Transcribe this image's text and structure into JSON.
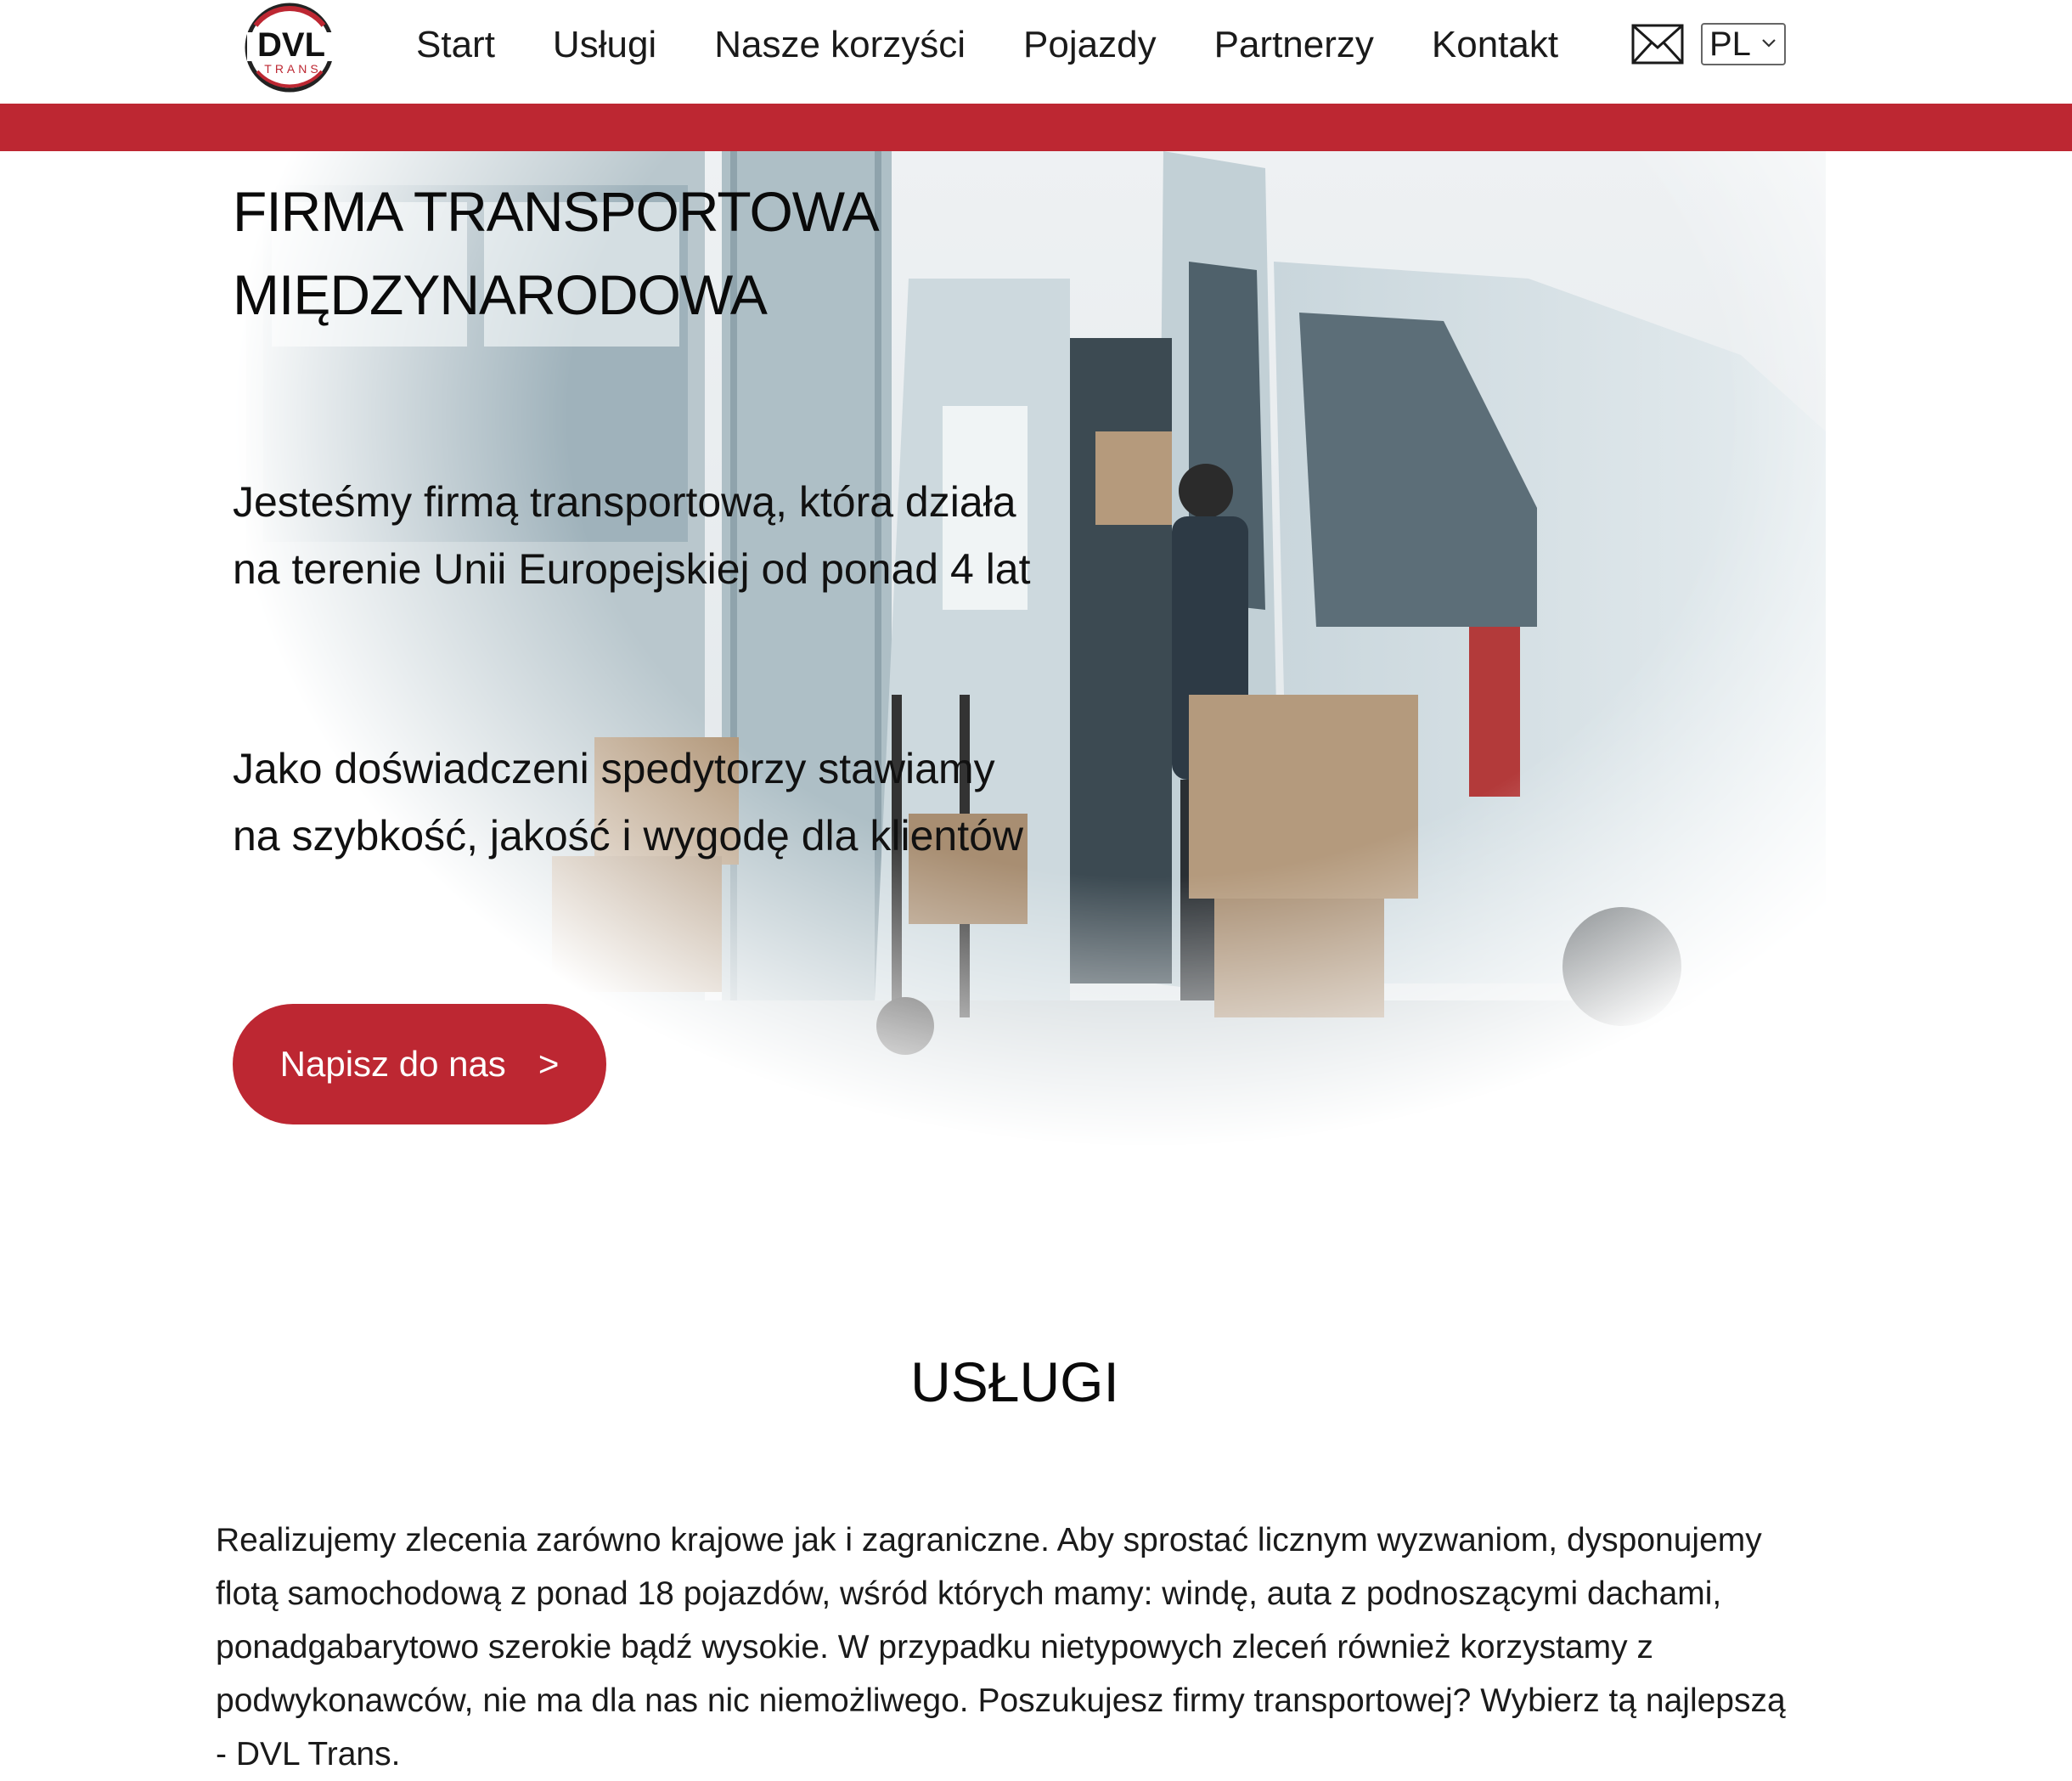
{
  "header": {
    "logo_text": "DVL",
    "logo_subtext": "TRANS",
    "nav": [
      {
        "label": "Start"
      },
      {
        "label": "Usługi"
      },
      {
        "label": "Nasze korzyści"
      },
      {
        "label": "Pojazdy"
      },
      {
        "label": "Partnerzy"
      },
      {
        "label": "Kontakt"
      }
    ],
    "mail_icon": "envelope-icon",
    "language": {
      "selected": "PL"
    }
  },
  "hero": {
    "title_line1": "FIRMA TRANSPORTOWA",
    "title_line2": "MIĘDZYNARODOWA",
    "paragraph1_line1": "Jesteśmy firmą transportową, która działa",
    "paragraph1_line2": "na terenie Unii Europejskiej od ponad 4 lat",
    "paragraph2_line1": "Jako doświadczeni spedytorzy stawiamy",
    "paragraph2_line2": "na szybkość, jakość i wygodę dla klientów",
    "cta_label": "Napisz do nas",
    "cta_arrow": ">",
    "image_subject": "courier loading boxes into a white delivery van"
  },
  "services": {
    "title": "USŁUGI",
    "text": "Realizujemy zlecenia zarówno krajowe jak i zagraniczne. Aby sprostać licznym wyzwaniom, dysponujemy flotą samochodową z ponad 18 pojazdów, wśród których mamy: windę, auta z podnoszącymi dachami, ponadgabarytowo szerokie bądź wysokie. W przypadku nietypowych zleceń również korzystamy z podwykonawców, nie ma dla nas nic niemożliwego. Poszukujesz firmy transportowej? Wybierz tą najlepszą - DVL Trans."
  },
  "colors": {
    "brand_red": "#bd2732",
    "text": "#111111",
    "background": "#ffffff"
  }
}
